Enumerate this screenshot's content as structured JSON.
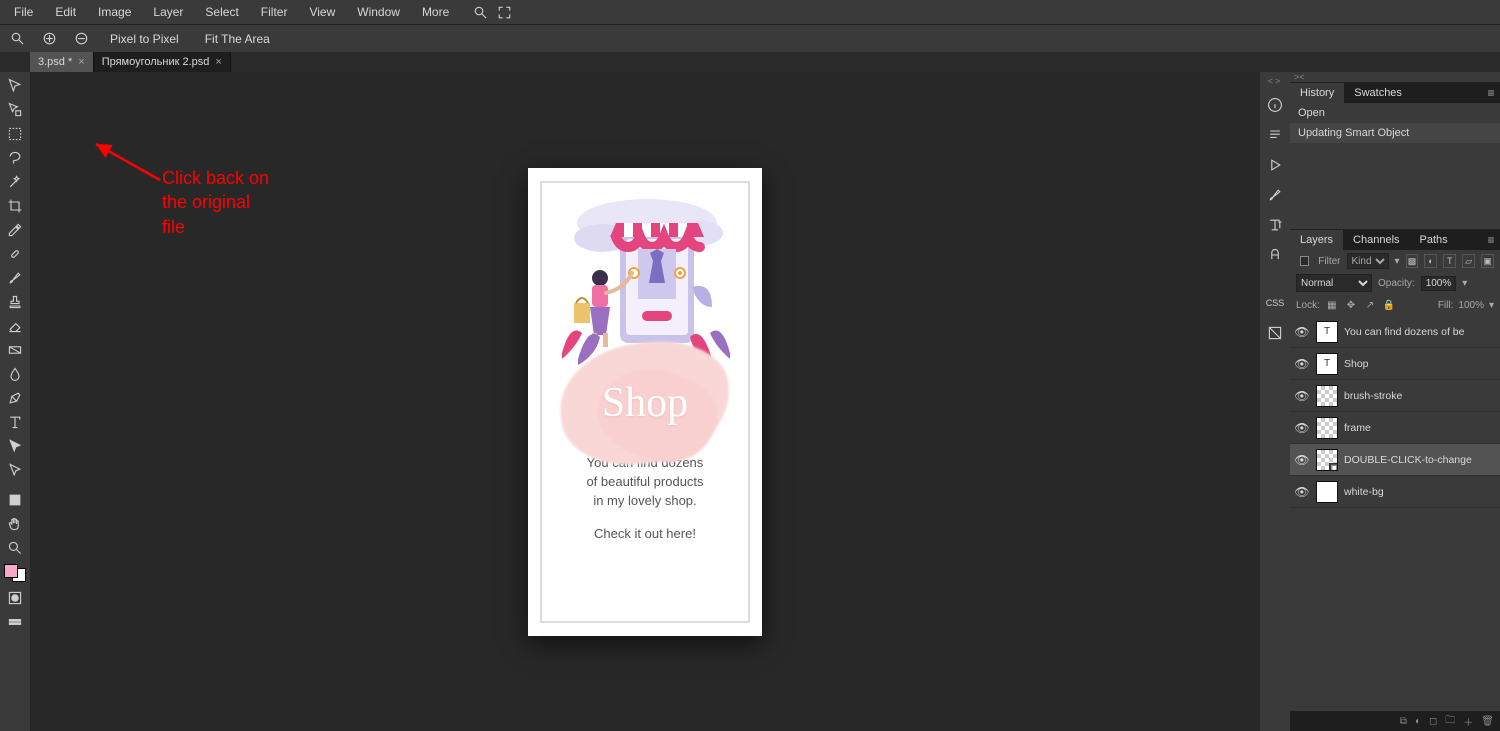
{
  "menu": {
    "items": [
      "File",
      "Edit",
      "Image",
      "Layer",
      "Select",
      "Filter",
      "View",
      "Window",
      "More"
    ]
  },
  "optbar": {
    "pixel_to_pixel": "Pixel to Pixel",
    "fit": "Fit The Area"
  },
  "tabs": [
    {
      "label": "3.psd *",
      "active": true
    },
    {
      "label": "Прямоугольник 2.psd",
      "active": false
    }
  ],
  "annotation": {
    "line1": "Click back on",
    "line2": "the original",
    "line3": "file"
  },
  "document": {
    "shop_title": "Shop",
    "body_l1": "You can find dozens",
    "body_l2": "of beautiful products",
    "body_l3": "in my lovely shop.",
    "body_l4": "Check it out here!"
  },
  "history_panel": {
    "tabs": [
      "History",
      "Swatches"
    ],
    "rows": [
      {
        "label": "Open",
        "sel": false
      },
      {
        "label": "Updating Smart Object",
        "sel": true
      }
    ]
  },
  "layers_panel": {
    "tabs": [
      "Layers",
      "Channels",
      "Paths"
    ],
    "filter_label": "Filter",
    "kind_label": "Kind",
    "blend_mode": "Normal",
    "opacity_label": "Opacity:",
    "opacity_value": "100%",
    "lock_label": "Lock:",
    "fill_label": "Fill:",
    "fill_value": "100%",
    "layers": [
      {
        "name": "You can find dozens of be",
        "thumb": "T",
        "sel": false,
        "type": "text"
      },
      {
        "name": "Shop",
        "thumb": "T",
        "sel": false,
        "type": "text"
      },
      {
        "name": "brush-stroke",
        "thumb": "checker",
        "sel": false,
        "type": "raster"
      },
      {
        "name": "frame",
        "thumb": "checker",
        "sel": false,
        "type": "raster"
      },
      {
        "name": "DOUBLE-CLICK-to-change",
        "thumb": "smart",
        "sel": true,
        "type": "smart"
      },
      {
        "name": "white-bg",
        "thumb": "white",
        "sel": false,
        "type": "raster"
      }
    ]
  }
}
